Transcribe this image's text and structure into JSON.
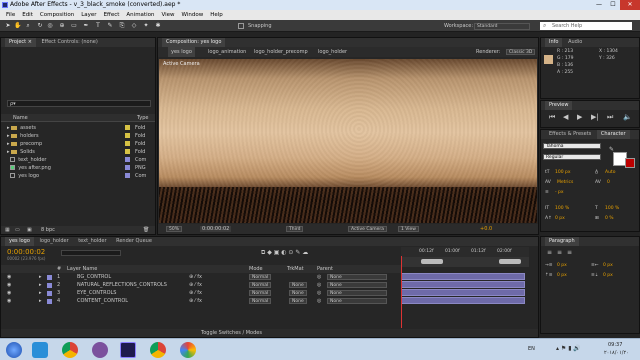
{
  "window": {
    "title": "Adobe After Effects - v_3_black_smoke (converted).aep *",
    "min": "—",
    "max": "☐",
    "close": "✕"
  },
  "menu": [
    "File",
    "Edit",
    "Composition",
    "Layer",
    "Effect",
    "Animation",
    "View",
    "Window",
    "Help"
  ],
  "toolbar": {
    "snapping": "Snapping",
    "workspace_label": "Workspace:",
    "workspace_value": "Standard",
    "search": "Search Help"
  },
  "project": {
    "tabs": [
      "Project ×",
      "Effect Controls: (none)"
    ],
    "search_placeholder": "ρ▾",
    "headers": {
      "name": "Name",
      "type": "Type"
    },
    "items": [
      {
        "name": "assets",
        "type": "Fold",
        "kind": "folder",
        "color": "#d6c244"
      },
      {
        "name": "holders",
        "type": "Fold",
        "kind": "folder",
        "color": "#d6c244"
      },
      {
        "name": "precomp",
        "type": "Fold",
        "kind": "folder",
        "color": "#d6c244"
      },
      {
        "name": "Solids",
        "type": "Fold",
        "kind": "folder",
        "color": "#d6c244"
      },
      {
        "name": "text_holder",
        "type": "Com",
        "kind": "comp",
        "color": "#8a8ad6"
      },
      {
        "name": "yes after.png",
        "type": "PNG",
        "kind": "file",
        "color": "#8a8ad6"
      },
      {
        "name": "yes logo",
        "type": "Com",
        "kind": "comp",
        "color": "#8a8ad6"
      }
    ],
    "bpc": "8 bpc"
  },
  "composition": {
    "tab": "Composition: yes logo",
    "breadcrumbs": [
      "yes logo",
      "logo_animation",
      "logo_holder_precomp",
      "logo_holder"
    ],
    "renderer_label": "Renderer:",
    "renderer_value": "Classic 3D",
    "active_camera_label": "Active Camera",
    "footer": {
      "zoom": "50%",
      "time": "0:00:00:02",
      "resolution": "Third",
      "camera": "Active Camera",
      "views": "1 View",
      "exposure": "+0.0"
    }
  },
  "info": {
    "tabs": [
      "Info",
      "Audio"
    ],
    "r": "R : 213",
    "g": "G : 179",
    "b": "B : 136",
    "a": "A : 255",
    "x": "X : 1304",
    "y": "Y : 326",
    "swatch": "#d5b388"
  },
  "preview": {
    "tab": "Preview"
  },
  "effects": {
    "tabs": [
      "Effects & Presets",
      "Character"
    ],
    "font": "Tahoma",
    "style": "Regular",
    "size": "100 px",
    "leading": "Auto",
    "kerning": "Metrics",
    "tracking": "0",
    "px": "- px",
    "vscale": "100 %",
    "hscale": "100 %",
    "baseline": "0 px",
    "tsume": "0 %"
  },
  "paragraph": {
    "tab": "Paragraph",
    "indent1": "0 px",
    "indent2": "0 px",
    "space1": "0 px",
    "space2": "0 px"
  },
  "timeline": {
    "tabs": [
      "yes logo",
      "logo_holder",
      "text_holder",
      "Render Queue"
    ],
    "timecode": "0:00:00:02",
    "frames": "00002 (23.976 fps)",
    "headers": {
      "num": "#",
      "layer": "Layer Name",
      "mode": "Mode",
      "trkmat": "TrkMat",
      "parent": "Parent"
    },
    "ruler": [
      "00:12f",
      "01:00f",
      "01:12f",
      "02:00f"
    ],
    "layers": [
      {
        "num": "1",
        "name": "BG_CONTROL",
        "mode": "Normal",
        "trk": "",
        "parent": "None"
      },
      {
        "num": "2",
        "name": "NATURAL_REFLECTIONS_CONTROLS",
        "mode": "Normal",
        "trk": "None",
        "parent": "None"
      },
      {
        "num": "3",
        "name": "EYE_CONTROLS",
        "mode": "Normal",
        "trk": "None",
        "parent": "None"
      },
      {
        "num": "4",
        "name": "CONTENT_CONTROL",
        "mode": "Normal",
        "trk": "None",
        "parent": "None"
      }
    ],
    "footer": "Toggle Switches / Modes"
  },
  "taskbar": {
    "lang": "EN",
    "time": "09:37",
    "date": "۲۰۱۸/۰۱/۲۰"
  }
}
